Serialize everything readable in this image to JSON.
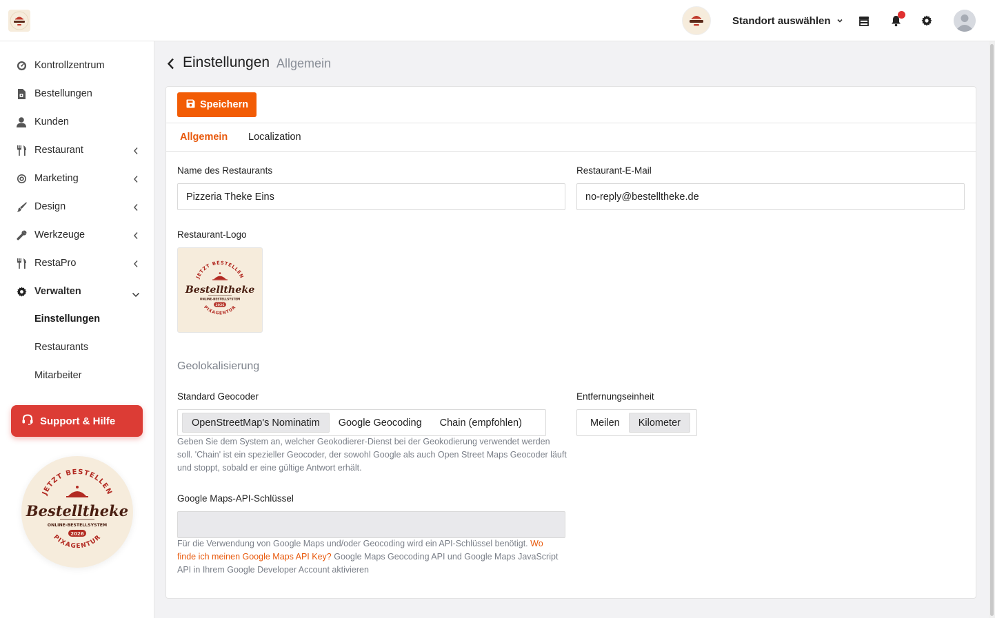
{
  "topbar": {
    "location_label": "Standort auswählen",
    "logo_icon": "bestelltheke-logo",
    "icons": [
      "store-icon",
      "bell-icon",
      "gear-icon",
      "user-avatar-icon"
    ]
  },
  "logo": {
    "top_text": "JETZT BESTELLEN",
    "brand": "Bestelltheke",
    "tagline": "ONLINE-BESTELLSYSTEM",
    "year": "2026",
    "bottom_text": "PIXAGENTUR"
  },
  "sidebar": {
    "items": [
      {
        "label": "Kontrollzentrum",
        "icon": "dashboard-icon"
      },
      {
        "label": "Bestellungen",
        "icon": "orders-icon"
      },
      {
        "label": "Kunden",
        "icon": "user-icon"
      },
      {
        "label": "Restaurant",
        "icon": "utensils-icon"
      },
      {
        "label": "Marketing",
        "icon": "target-icon"
      },
      {
        "label": "Design",
        "icon": "brush-icon"
      },
      {
        "label": "Werkzeuge",
        "icon": "wrench-icon"
      },
      {
        "label": "RestaPro",
        "icon": "utensils-icon"
      },
      {
        "label": "Verwalten",
        "icon": "gear-icon"
      }
    ],
    "sub_items": [
      "Einstellungen",
      "Restaurants",
      "Mitarbeiter"
    ],
    "support_label": "Support & Hilfe"
  },
  "page": {
    "title": "Einstellungen",
    "subtitle": "Allgemein"
  },
  "toolbar": {
    "save_label": "Speichern"
  },
  "tabs": [
    "Allgemein",
    "Localization"
  ],
  "form": {
    "name_label": "Name des Restaurants",
    "name_value": "Pizzeria Theke Eins",
    "email_label": "Restaurant-E-Mail",
    "email_value": "no-reply@bestelltheke.de",
    "logo_label": "Restaurant-Logo",
    "geo_heading": "Geolokalisierung",
    "geocoder_label": "Standard Geocoder",
    "geocoder_options": [
      "OpenStreetMap's Nominatim",
      "Google Geocoding",
      "Chain (empfohlen)"
    ],
    "geocoder_selected": "OpenStreetMap's Nominatim",
    "geocoder_help": "Geben Sie dem System an, welcher Geokodierer-Dienst bei der Geokodierung verwendet werden soll. 'Chain' ist ein spezieller Geocoder, der sowohl Google als auch Open Street Maps Geocoder läuft und stoppt, sobald er eine gültige Antwort erhält.",
    "distance_label": "Entfernungseinheit",
    "distance_options": [
      "Meilen",
      "Kilometer"
    ],
    "distance_selected": "Kilometer",
    "api_label": "Google Maps-API-Schlüssel",
    "api_value": "",
    "api_help_before": "Für die Verwendung von Google Maps und/oder Geocoding wird ein API-Schlüssel benötigt.",
    "api_help_link": "Wo finde ich meinen Google Maps API Key?",
    "api_help_after": "Google Maps Geocoding API und Google Maps JavaScript API in Ihrem Google Developer Account aktivieren"
  },
  "colors": {
    "accent": "#f25c05",
    "link": "#e8590c",
    "support": "#dc3c35",
    "brand_red": "#b22a22"
  }
}
